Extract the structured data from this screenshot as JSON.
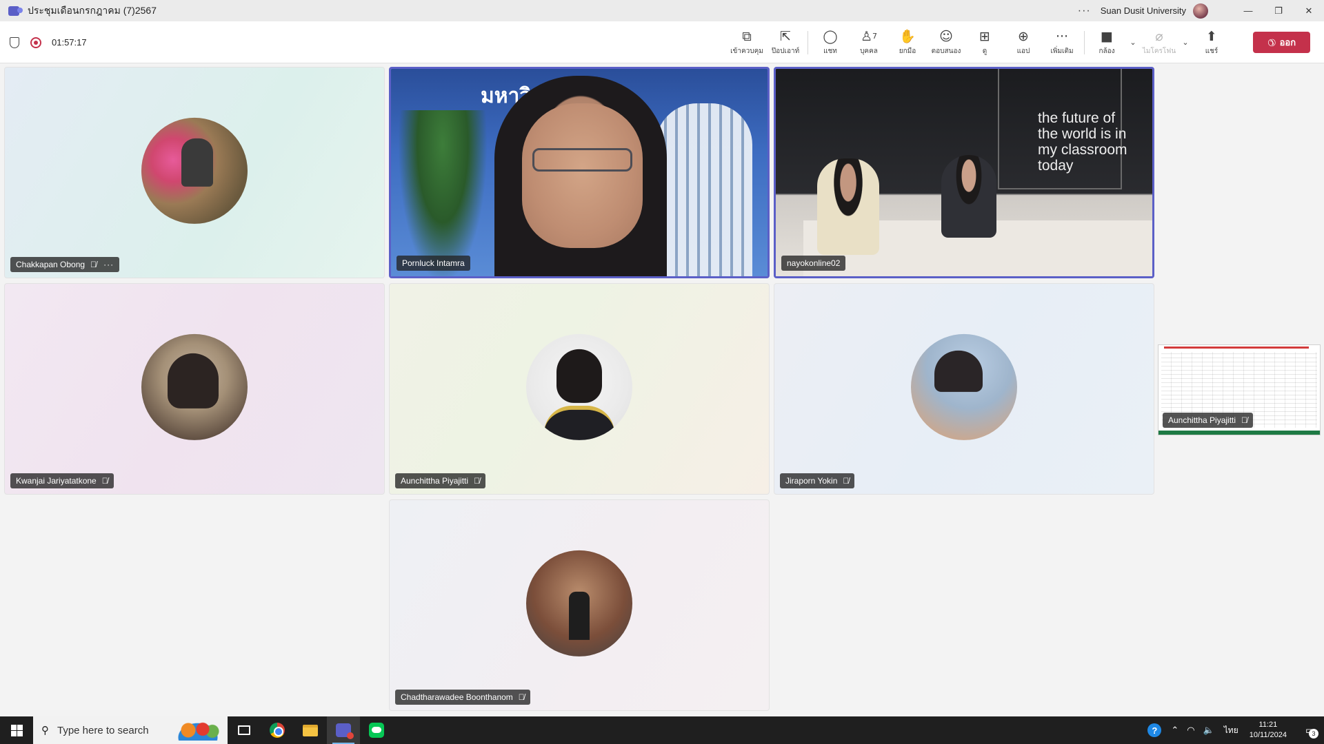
{
  "window": {
    "title": "ประชุมเดือนกรกฎาคม (7)2567",
    "org_name": "Suan Dusit University",
    "more": "···",
    "min": "—",
    "restore": "❐",
    "close": "✕"
  },
  "toolbar": {
    "timer": "01:57:17",
    "buttons": [
      {
        "label": "เข้าควบคุม",
        "icon": "take-control-icon"
      },
      {
        "label": "ป๊อปเอาท์",
        "icon": "pop-out-icon"
      },
      {
        "label": "แชท",
        "icon": "chat-icon"
      },
      {
        "label": "บุคคล",
        "icon": "people-icon",
        "count": "7"
      },
      {
        "label": "ยกมือ",
        "icon": "raise-hand-icon"
      },
      {
        "label": "ตอบสนอง",
        "icon": "react-icon"
      },
      {
        "label": "ดู",
        "icon": "view-icon"
      },
      {
        "label": "แอป",
        "icon": "apps-icon"
      },
      {
        "label": "เพิ่มเติม",
        "icon": "more-icon"
      },
      {
        "label": "กล้อง",
        "icon": "camera-off-icon"
      },
      {
        "label": "ไมโครโฟน",
        "icon": "mic-off-icon"
      },
      {
        "label": "แชร์",
        "icon": "share-icon"
      }
    ],
    "leave_label": "ออก"
  },
  "participants": [
    {
      "name": "Chakkapan Obong",
      "muted": true,
      "video": false
    },
    {
      "name": "Pornluck Intamra",
      "muted": false,
      "video": true
    },
    {
      "name": "nayokonline02",
      "muted": false,
      "video": true
    },
    {
      "name": "Kwanjai Jariyatatkone",
      "muted": true,
      "video": false
    },
    {
      "name": "Aunchittha Piyajitti",
      "muted": true,
      "video": false
    },
    {
      "name": "Jiraporn Yokin",
      "muted": true,
      "video": false
    },
    {
      "name": "Chadtharawadee Boonthanom",
      "muted": true,
      "video": false
    }
  ],
  "video_text": {
    "banner": "มหาวิ   วนดุสิต",
    "slogan": "the future of the world is in my classroom today"
  },
  "share_thumbnail": {
    "name": "Aunchittha Piyajitti"
  },
  "taskbar": {
    "search_placeholder": "Type here to search",
    "language": "ไทย",
    "time": "11:21",
    "date": "10/11/2024",
    "notification_count": "3"
  },
  "colors": {
    "accent": "#5b5fc7",
    "leave": "#c4314b",
    "taskbar": "#1f1f1f"
  }
}
